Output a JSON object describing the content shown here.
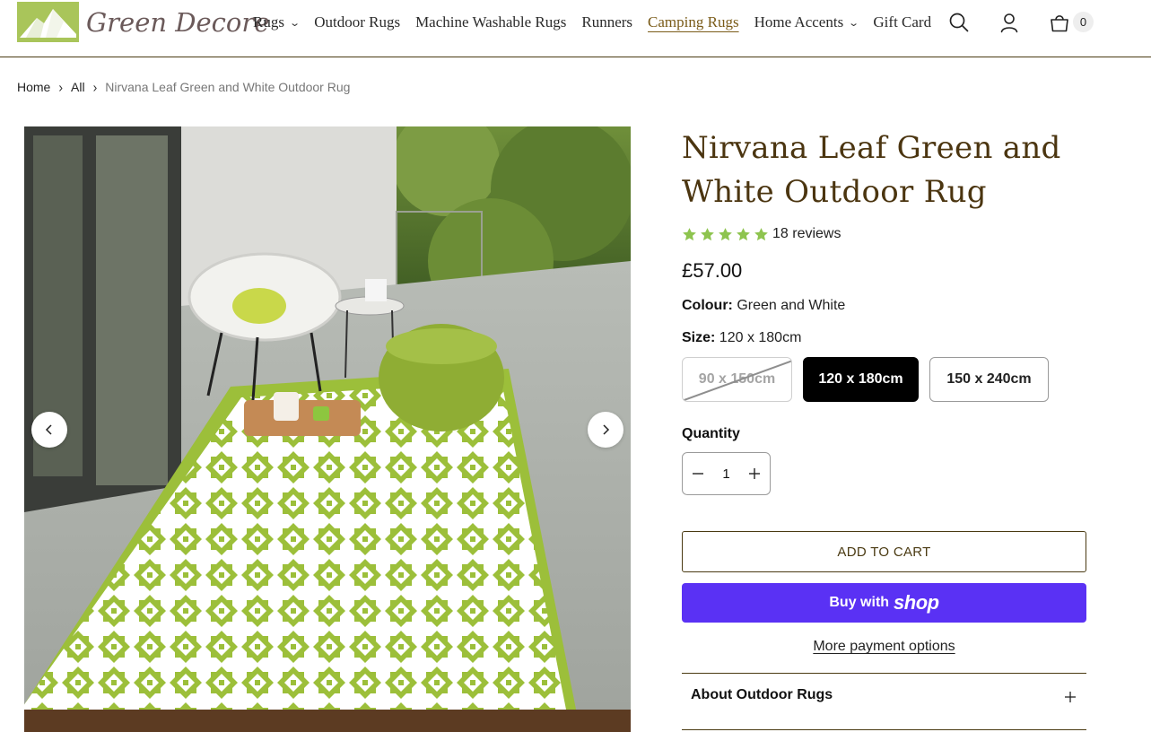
{
  "brand": {
    "name": "Green Decore"
  },
  "nav": {
    "items": [
      {
        "label": "Rugs",
        "has_dropdown": true,
        "active": false
      },
      {
        "label": "Outdoor Rugs",
        "has_dropdown": false,
        "active": false
      },
      {
        "label": "Machine Washable Rugs",
        "has_dropdown": false,
        "active": false
      },
      {
        "label": "Runners",
        "has_dropdown": false,
        "active": false
      },
      {
        "label": "Camping Rugs",
        "has_dropdown": false,
        "active": true
      },
      {
        "label": "Home Accents",
        "has_dropdown": true,
        "active": false
      },
      {
        "label": "Gift Card",
        "has_dropdown": false,
        "active": false
      }
    ],
    "icons": {
      "search": "search-icon",
      "account": "user-icon",
      "cart": "bag-icon"
    },
    "cart_count": "0"
  },
  "breadcrumb": {
    "home": "Home",
    "all": "All",
    "current": "Nirvana Leaf Green and White Outdoor Rug"
  },
  "product": {
    "title": "Nirvana Leaf Green and White Outdoor Rug",
    "rating": 5,
    "reviews_text": "18 reviews",
    "price": "£57.00",
    "colour_label": "Colour:",
    "colour_value": "Green and White",
    "size_label": "Size:",
    "size_value": "120 x 180cm",
    "sizes": [
      {
        "label": "90 x 150cm",
        "state": "unavailable"
      },
      {
        "label": "120 x 180cm",
        "state": "selected"
      },
      {
        "label": "150 x 240cm",
        "state": "available"
      }
    ],
    "quantity_label": "Quantity",
    "quantity": "1",
    "add_to_cart": "ADD TO CART",
    "buy_with": "Buy with",
    "shop_word": "shop",
    "more_payment": "More payment options",
    "accordion_title": "About Outdoor Rugs"
  },
  "colors": {
    "brand_brown": "#4a3a12",
    "rug_green": "#9cbf3a",
    "shop_pay": "#5a31f4",
    "star_green": "#8ec44f"
  }
}
